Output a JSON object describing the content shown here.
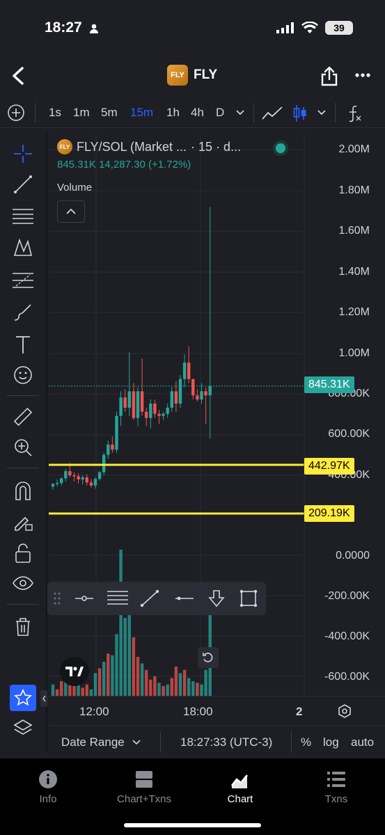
{
  "status_bar": {
    "time": "18:27",
    "battery": "39"
  },
  "header": {
    "title": "FLY",
    "logo_text": "FLY"
  },
  "timeframes": [
    "1s",
    "1m",
    "5m",
    "15m",
    "1h",
    "4h",
    "D"
  ],
  "active_timeframe": "15m",
  "legend": {
    "symbol": "FLY/SOL (Market ...",
    "interval": "· 15 · d...",
    "price": "845.31K",
    "change_value": "14,287.30",
    "change_pct": "(+1.72%)",
    "volume_label": "Volume"
  },
  "price_axis": [
    "2.00M",
    "1.80M",
    "1.60M",
    "1.40M",
    "1.20M",
    "1.00M",
    "800.00K",
    "600.00K",
    "400.00K"
  ],
  "volume_axis": [
    "0.0000",
    "-200.00K",
    "-400.00K",
    "-600.00K"
  ],
  "badges": {
    "current": "845.31K",
    "line1": "442.97K",
    "line2": "209.19K"
  },
  "time_axis": {
    "t1": "12:00",
    "t2": "18:00",
    "page": "2"
  },
  "bottom": {
    "date_range": "Date Range",
    "clock": "18:27:33 (UTC-3)",
    "pct": "%",
    "log": "log",
    "auto": "auto"
  },
  "tabs": [
    {
      "label": "Info",
      "icon": "info-icon"
    },
    {
      "label": "Chart+Txns",
      "icon": "split-icon"
    },
    {
      "label": "Chart",
      "icon": "chart-icon"
    },
    {
      "label": "Txns",
      "icon": "list-icon"
    }
  ],
  "colors": {
    "up": "#26a69a",
    "down": "#ef5350",
    "accent": "#2962ff",
    "hline": "#ffeb3b"
  },
  "chart_data": {
    "type": "candlestick",
    "title": "FLY/SOL",
    "x_labels": [
      "12:00",
      "18:00"
    ],
    "ylim": [
      300000,
      2100000
    ],
    "horizontal_lines": [
      442970,
      209190
    ],
    "candles": [
      [
        355000,
        372000,
        340000,
        368000
      ],
      [
        368000,
        390000,
        355000,
        372000
      ],
      [
        372000,
        400000,
        360000,
        395000
      ],
      [
        395000,
        440000,
        380000,
        430000
      ],
      [
        430000,
        470000,
        400000,
        410000
      ],
      [
        410000,
        425000,
        380000,
        405000
      ],
      [
        405000,
        420000,
        370000,
        390000
      ],
      [
        390000,
        410000,
        365000,
        400000
      ],
      [
        400000,
        415000,
        360000,
        375000
      ],
      [
        375000,
        392000,
        350000,
        360000
      ],
      [
        360000,
        400000,
        345000,
        392000
      ],
      [
        392000,
        430000,
        385000,
        425000
      ],
      [
        425000,
        520000,
        410000,
        510000
      ],
      [
        510000,
        580000,
        490000,
        560000
      ],
      [
        560000,
        600000,
        520000,
        535000
      ],
      [
        535000,
        720000,
        520000,
        700000
      ],
      [
        700000,
        820000,
        650000,
        790000
      ],
      [
        790000,
        830000,
        720000,
        740000
      ],
      [
        740000,
        1010000,
        700000,
        820000
      ],
      [
        820000,
        860000,
        680000,
        690000
      ],
      [
        690000,
        840000,
        650000,
        820000
      ],
      [
        820000,
        980000,
        700000,
        720000
      ],
      [
        720000,
        740000,
        650000,
        690000
      ],
      [
        690000,
        780000,
        640000,
        760000
      ],
      [
        760000,
        780000,
        690000,
        710000
      ],
      [
        710000,
        730000,
        660000,
        700000
      ],
      [
        700000,
        720000,
        680000,
        710000
      ],
      [
        710000,
        760000,
        690000,
        740000
      ],
      [
        740000,
        840000,
        720000,
        820000
      ],
      [
        820000,
        870000,
        720000,
        760000
      ],
      [
        760000,
        900000,
        740000,
        880000
      ],
      [
        880000,
        1000000,
        840000,
        960000
      ],
      [
        960000,
        1040000,
        860000,
        880000
      ],
      [
        880000,
        880000,
        780000,
        800000
      ],
      [
        800000,
        830000,
        770000,
        780000
      ],
      [
        780000,
        860000,
        760000,
        820000
      ],
      [
        820000,
        840000,
        660000,
        800000
      ],
      [
        800000,
        1720000,
        590000,
        845310
      ]
    ],
    "volume": [
      [
        70000,
        "up"
      ],
      [
        40000,
        "down"
      ],
      [
        90000,
        "down"
      ],
      [
        110000,
        "up"
      ],
      [
        150000,
        "down"
      ],
      [
        60000,
        "down"
      ],
      [
        80000,
        "up"
      ],
      [
        50000,
        "down"
      ],
      [
        70000,
        "down"
      ],
      [
        40000,
        "up"
      ],
      [
        140000,
        "up"
      ],
      [
        170000,
        "down"
      ],
      [
        210000,
        "up"
      ],
      [
        260000,
        "down"
      ],
      [
        250000,
        "up"
      ],
      [
        380000,
        "up"
      ],
      [
        900000,
        "up"
      ],
      [
        480000,
        "up"
      ],
      [
        520000,
        "up"
      ],
      [
        360000,
        "down"
      ],
      [
        240000,
        "down"
      ],
      [
        200000,
        "up"
      ],
      [
        160000,
        "down"
      ],
      [
        100000,
        "down"
      ],
      [
        120000,
        "down"
      ],
      [
        80000,
        "up"
      ],
      [
        60000,
        "down"
      ],
      [
        70000,
        "up"
      ],
      [
        110000,
        "down"
      ],
      [
        180000,
        "down"
      ],
      [
        140000,
        "up"
      ],
      [
        160000,
        "down"
      ],
      [
        110000,
        "up"
      ],
      [
        90000,
        "up"
      ],
      [
        80000,
        "down"
      ],
      [
        70000,
        "up"
      ],
      [
        160000,
        "up"
      ],
      [
        620000,
        "up"
      ]
    ]
  }
}
